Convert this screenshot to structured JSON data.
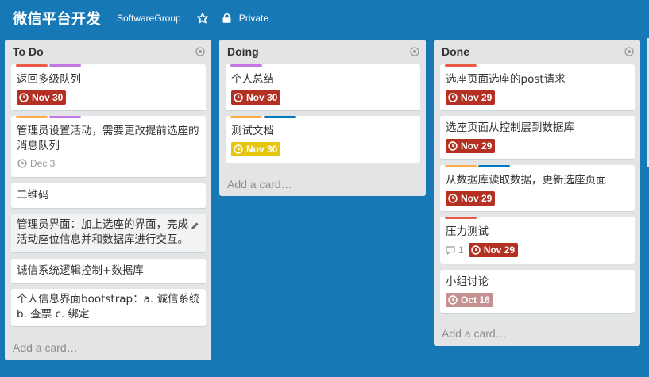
{
  "header": {
    "board_title": "微信平台开发",
    "team": "SoftwareGroup",
    "star_icon": "star-icon",
    "lock_icon": "lock-icon",
    "visibility": "Private"
  },
  "colors": {
    "background": "#1778b6",
    "list": "#e2e4e6",
    "label_red": "#eb5a46",
    "label_purple": "#c377e0",
    "label_orange": "#ffab4a",
    "label_blue": "#0079bf",
    "due_overdue": "#b33023",
    "due_soon": "#e6c60d",
    "due_past_complete": "#c49090"
  },
  "lists": [
    {
      "title": "To Do",
      "add_card": "Add a card…",
      "cards": [
        {
          "title": "返回多级队列",
          "labels": [
            "red",
            "purple"
          ],
          "due": "Nov 30"
        },
        {
          "title": "管理员设置活动，需要更改提前选座的消息队列",
          "labels": [
            "orange",
            "purple"
          ],
          "due": "Dec 3"
        },
        {
          "title": "二维码"
        },
        {
          "title": "管理员界面：加上选座的界面，完成活动座位信息并和数据库进行交互。"
        },
        {
          "title": "诚信系统逻辑控制+数据库"
        },
        {
          "title": "个人信息界面bootstrap：a. 诚信系统 b. 查票 c. 绑定"
        }
      ]
    },
    {
      "title": "Doing",
      "add_card": "Add a card…",
      "cards": [
        {
          "title": "个人总结",
          "labels": [
            "purple"
          ],
          "due": "Nov 30"
        },
        {
          "title": "测试文档",
          "labels": [
            "orange",
            "blue"
          ],
          "due": "Nov 30"
        }
      ]
    },
    {
      "title": "Done",
      "add_card": "Add a card…",
      "cards": [
        {
          "title": "选座页面选座的post请求",
          "labels": [
            "red"
          ],
          "due": "Nov 29"
        },
        {
          "title": "选座页面从控制层到数据库",
          "due": "Nov 29"
        },
        {
          "title": "从数据库读取数据，更新选座页面",
          "labels": [
            "orange",
            "blue"
          ],
          "due": "Nov 29"
        },
        {
          "title": "压力测试",
          "labels": [
            "red"
          ],
          "comments": "1",
          "due": "Nov 29"
        },
        {
          "title": "小组讨论",
          "due": "Oct 16"
        }
      ]
    }
  ]
}
